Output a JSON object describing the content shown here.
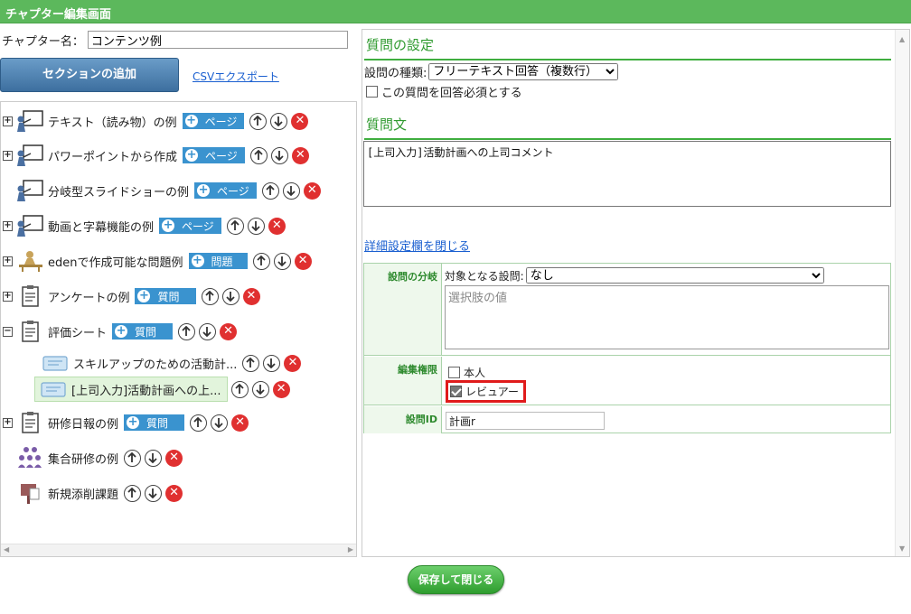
{
  "window": {
    "title": "チャプター編集画面"
  },
  "left": {
    "chapter_name_label": "チャプター名：",
    "chapter_name_value": "コンテンツ例",
    "add_section_button": "セクションの追加",
    "csv_export_link": "CSVエクスポート",
    "tree": [
      {
        "label": "テキスト（読み物）の例",
        "expander": "+",
        "icon": "presenter-icon",
        "pill": "ページ",
        "children_open": false
      },
      {
        "label": "パワーポイントから作成",
        "expander": "+",
        "icon": "presenter-icon",
        "pill": "ページ"
      },
      {
        "label": "分岐型スライドショーの例",
        "expander": "",
        "icon": "presenter-icon",
        "pill": "ページ"
      },
      {
        "label": "動画と字幕機能の例",
        "expander": "+",
        "icon": "presenter-icon",
        "pill": "ページ"
      },
      {
        "label": "edenで作成可能な問題例",
        "expander": "+",
        "icon": "desk-person-icon",
        "pill": "問題"
      },
      {
        "label": "アンケートの例",
        "expander": "+",
        "icon": "clipboard-icon",
        "pill": "質問"
      },
      {
        "label": "評価シート",
        "expander": "−",
        "icon": "clipboard-icon",
        "pill": "質問"
      },
      {
        "label": "スキルアップのための活動計...",
        "expander": "",
        "icon": "question-card-icon",
        "pill": ""
      },
      {
        "label": "[上司入力]活動計画への上...",
        "expander": "",
        "icon": "question-card-icon",
        "pill": "",
        "selected": true
      },
      {
        "label": "研修日報の例",
        "expander": "+",
        "icon": "clipboard-icon",
        "pill": "質問"
      },
      {
        "label": "集合研修の例",
        "expander": "",
        "icon": "group-icon",
        "pill": ""
      },
      {
        "label": "新規添削課題",
        "expander": "",
        "icon": "post-icon",
        "pill": ""
      }
    ],
    "scroll_left": "◀",
    "scroll_right": "▶"
  },
  "right": {
    "question_settings_heading": "質問の設定",
    "question_type_label": "設問の種類:",
    "question_type_value": "フリーテキスト回答（複数行）",
    "required_label": "この質問を回答必須とする",
    "required_checked": false,
    "question_text_heading": "質問文",
    "question_text_value": "[上司入力]活動計画への上司コメント",
    "advanced_toggle_link": "詳細設定欄を閉じる",
    "branch_label": "設問の分岐",
    "branch_target_label": "対象となる設問:",
    "branch_target_value": "なし",
    "choice_placeholder": "選択肢の値",
    "edit_permission_label": "編集権限",
    "perm_self_label": "本人",
    "perm_self_checked": false,
    "perm_reviewer_label": "レビュアー",
    "perm_reviewer_checked": true,
    "question_id_label": "設問ID",
    "question_id_value": "計画r",
    "scroll_up": "▲",
    "scroll_down": "▼"
  },
  "footer": {
    "save_close_button": "保存して閉じる"
  },
  "colors": {
    "titlebar": "#5cb85c",
    "accent_green": "#3fae3f",
    "pill_blue": "#3a93cf",
    "delete_red": "#e03030",
    "highlight_red": "#e01b1b"
  }
}
